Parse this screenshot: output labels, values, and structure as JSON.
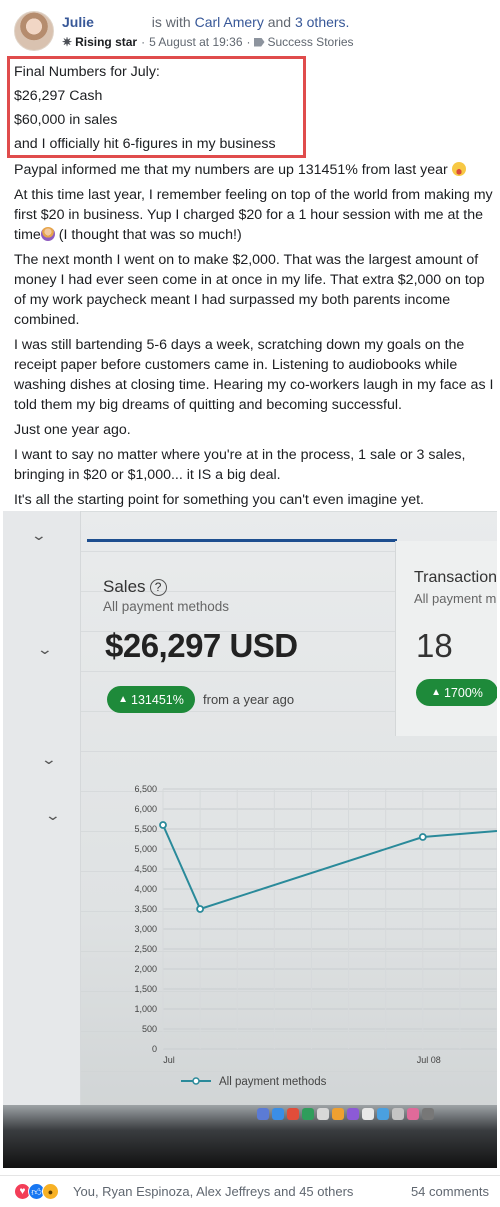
{
  "header": {
    "author": "Julie",
    "with_text": "is with",
    "tagged_person": "Carl Amery",
    "and_text": "and",
    "others_link": "3 others.",
    "badge_label": "Rising star",
    "separator": "·",
    "timestamp": "5 August at 19:36",
    "group_name": "Success Stories"
  },
  "post": {
    "highlighted_lines": [
      "Final Numbers for July:",
      "$26,297 Cash",
      "$60,000 in sales",
      "and I officially hit 6-figures in my business"
    ],
    "paragraph_1": "Paypal informed me that my numbers are up 131451% from last year",
    "paragraph_2": "At this time last year, I remember feeling on top of the world from making my first $20 in business. Yup I charged $20 for a 1 hour session with me at the time",
    "paragraph_2_tail": " (I thought that was so much!)",
    "paragraph_3": "The next month I went on to make $2,000. That was the largest amount of money I had ever seen come in at once in my life. That extra $2,000 on top of my work paycheck meant I had surpassed my both parents income combined.",
    "paragraph_4": "I was still bartending 5-6 days a week, scratching down my goals on the receipt paper before customers came in. Listening to audiobooks while washing dishes at closing time. Hearing my co-workers laugh in my face as I told them my big dreams of quitting and becoming successful.",
    "paragraph_5": "Just one year ago.",
    "paragraph_6": "I want to say no matter where you're at in the process, 1 sale or 3 sales, bringing in $20 or $1,000... it IS a big deal.",
    "paragraph_7": "It's all the starting point for something you can't even imagine yet."
  },
  "photo": {
    "sales_label": "Sales",
    "sales_sub": "All payment methods",
    "sales_amount": "$26,297 USD",
    "sales_pill": "131451%",
    "sales_from": "from a year ago",
    "transactions_label": "Transactions",
    "transactions_sub": "All payment m",
    "transactions_count": "18",
    "transactions_pill": "1700%"
  },
  "chart_data": {
    "type": "line",
    "title": "",
    "xlabel": "",
    "ylabel": "",
    "x_tick_labels": [
      "Jul",
      "Jul 08"
    ],
    "y_ticks": [
      0,
      500,
      1000,
      1500,
      2000,
      2500,
      3000,
      3500,
      4000,
      4500,
      5000,
      5500,
      6000,
      6500
    ],
    "y_tick_labels": [
      "0",
      "500",
      "1,000",
      "1,500",
      "2,000",
      "2,500",
      "3,000",
      "3,500",
      "4,000",
      "4,500",
      "5,000",
      "5,500",
      "6,000",
      "6,500"
    ],
    "ylim": [
      0,
      6500
    ],
    "x_day_values": [
      1,
      2,
      8
    ],
    "series": [
      {
        "name": "All payment methods",
        "values": [
          5600,
          3500,
          5300
        ]
      }
    ],
    "legend_position": "bottom",
    "grid": true,
    "line_color": "#2a8a9a"
  },
  "footer": {
    "reaction_icons": [
      "love-icon",
      "like-icon",
      "wow-icon"
    ],
    "reacted_by": "You, Ryan Espinoza, Alex Jeffreys and 45 others",
    "comments": "54 comments"
  }
}
